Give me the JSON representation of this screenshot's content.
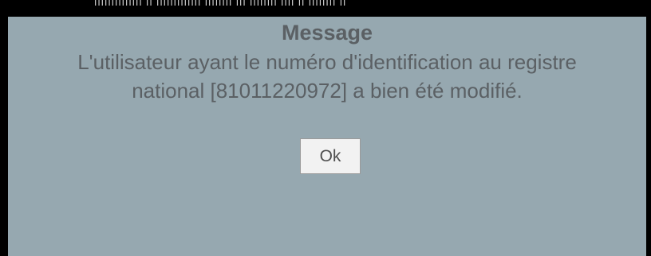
{
  "background_fragment": {
    "text": "IIIIIIIIIIIIII II IIIIIIIIIIIII IIIIIIII III IIIIIIII IIII II IIIIIIII II"
  },
  "dialog": {
    "title": "Message",
    "message_line1": "L'utilisateur ayant le numéro d'identification au registre",
    "message_line2": "national [81011220972] a bien été modifié.",
    "ok_label": "Ok",
    "colors": {
      "background": "#96a8b0",
      "text": "#5b6064",
      "button_bg": "#f2f2f2"
    }
  }
}
